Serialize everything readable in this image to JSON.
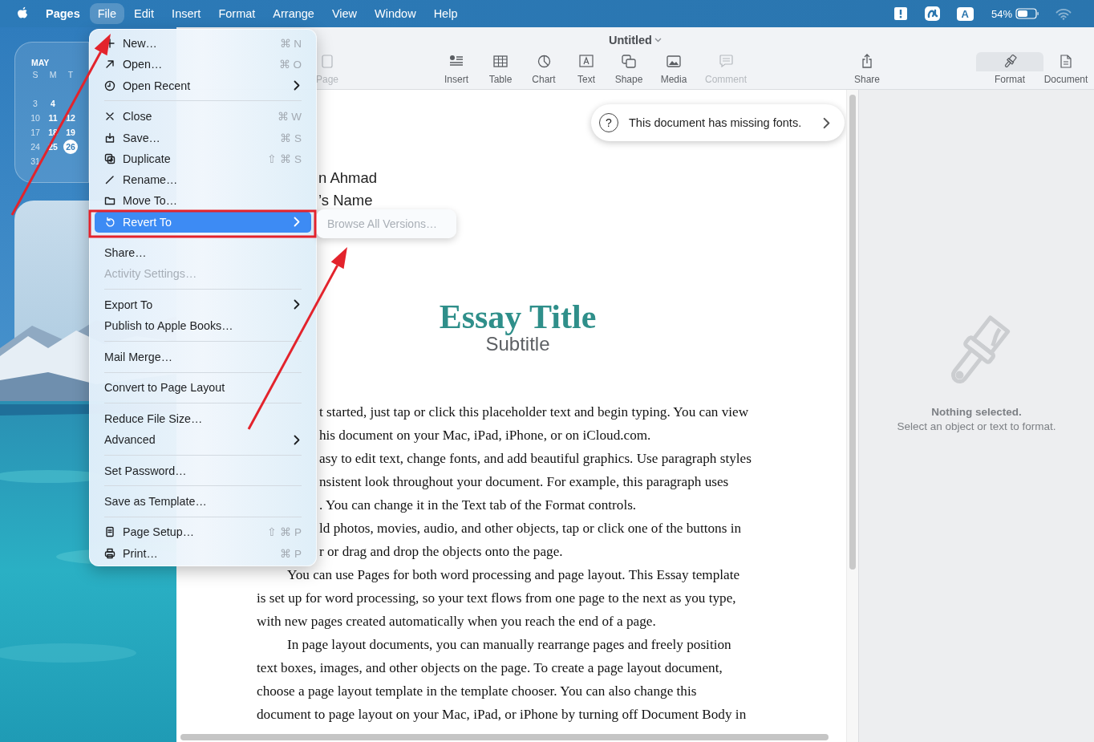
{
  "menu_bar": {
    "items": [
      {
        "label": "Pages",
        "kind": "app",
        "selected": false
      },
      {
        "label": "File",
        "kind": "menu",
        "selected": true
      },
      {
        "label": "Edit",
        "kind": "menu",
        "selected": false
      },
      {
        "label": "Insert",
        "kind": "menu",
        "selected": false
      },
      {
        "label": "Format",
        "kind": "menu",
        "selected": false
      },
      {
        "label": "Arrange",
        "kind": "menu",
        "selected": false
      },
      {
        "label": "View",
        "kind": "menu",
        "selected": false
      },
      {
        "label": "Window",
        "kind": "menu",
        "selected": false
      },
      {
        "label": "Help",
        "kind": "menu",
        "selected": false
      }
    ],
    "status": {
      "input_source": "A",
      "battery_percent": "54%"
    }
  },
  "desktop": {
    "calendar": {
      "month": "MAY",
      "weekdays": [
        "S",
        "M",
        "T"
      ],
      "weeks": [
        [
          {
            "day": "3",
            "selected": false
          },
          {
            "day": "4",
            "selected": false
          }
        ],
        [
          {
            "day": "10",
            "selected": false
          },
          {
            "day": "11",
            "selected": false
          },
          {
            "day": "12",
            "selected": false
          }
        ],
        [
          {
            "day": "17",
            "selected": false
          },
          {
            "day": "18",
            "selected": false
          },
          {
            "day": "19",
            "selected": false
          }
        ],
        [
          {
            "day": "24",
            "selected": false
          },
          {
            "day": "25",
            "selected": false
          },
          {
            "day": "26",
            "selected": true
          }
        ],
        [
          {
            "day": "31",
            "selected": false
          }
        ]
      ]
    }
  },
  "window": {
    "title": "Untitled",
    "toolbar": [
      {
        "label": "Page",
        "disabled": true,
        "selected": false
      },
      {
        "label": "Insert",
        "disabled": false,
        "selected": false
      },
      {
        "label": "Table",
        "disabled": false,
        "selected": false
      },
      {
        "label": "Chart",
        "disabled": false,
        "selected": false
      },
      {
        "label": "Text",
        "disabled": false,
        "selected": false
      },
      {
        "label": "Shape",
        "disabled": false,
        "selected": false
      },
      {
        "label": "Media",
        "disabled": false,
        "selected": false
      },
      {
        "label": "Comment",
        "disabled": true,
        "selected": false
      },
      {
        "label": "Share",
        "disabled": false,
        "selected": false
      },
      {
        "label": "Format",
        "disabled": false,
        "selected": true
      },
      {
        "label": "Document",
        "disabled": false,
        "selected": false
      }
    ]
  },
  "notice": {
    "help_glyph": "?",
    "text": "This document has missing fonts."
  },
  "document": {
    "author_lines": [
      "n Ahmad",
      "’s Name"
    ],
    "title": "Essay Title",
    "subtitle": "Subtitle",
    "lines": [
      {
        "kind": "cut",
        "text": "t started, just tap or click this placeholder text and begin typing. You can view"
      },
      {
        "kind": "cut",
        "text": "his document on your Mac, iPad, iPhone, or on iCloud.com."
      },
      {
        "kind": "cut",
        "text": "asy to edit text, change fonts, and add beautiful graphics. Use paragraph styles"
      },
      {
        "kind": "cut",
        "text": "nsistent look throughout your document. For example, this paragraph uses"
      },
      {
        "kind": "cut",
        "text": ". You can change it in the Text tab of the Format controls."
      },
      {
        "kind": "cut",
        "text": "ld photos, movies, audio, and other objects, tap or click one of the buttons in"
      },
      {
        "kind": "cut",
        "text": "r or drag and drop the objects onto the page."
      },
      {
        "kind": "indent",
        "text": "You can use Pages for both word processing and page layout. This Essay template"
      },
      {
        "kind": "plain",
        "text": "is set up for word processing, so your text flows from one page to the next as you type,"
      },
      {
        "kind": "plain",
        "text": "with new pages created automatically when you reach the end of a page."
      },
      {
        "kind": "indent",
        "text": "In page layout documents, you can manually rearrange pages and freely position"
      },
      {
        "kind": "plain",
        "text": "text boxes, images, and other objects on the page. To create a page layout document,"
      },
      {
        "kind": "plain",
        "text": "choose a page layout template in the template chooser. You can also change this"
      },
      {
        "kind": "plain",
        "text": "document to page layout on your Mac, iPad, or iPhone by turning off Document Body in"
      }
    ]
  },
  "inspector": {
    "heading": "Nothing selected.",
    "hint": "Select an object or text to format."
  },
  "file_menu": [
    {
      "kind": "item",
      "label": "New…",
      "shortcut": "⌘ N",
      "submenu": false,
      "disabled": false,
      "selected": false
    },
    {
      "kind": "item",
      "label": "Open…",
      "shortcut": "⌘ O",
      "submenu": false,
      "disabled": false,
      "selected": false
    },
    {
      "kind": "item",
      "label": "Open Recent",
      "submenu": true,
      "disabled": false,
      "selected": false
    },
    {
      "kind": "separator"
    },
    {
      "kind": "item",
      "label": "Close",
      "shortcut": "⌘ W",
      "submenu": false,
      "disabled": false,
      "selected": false
    },
    {
      "kind": "item",
      "label": "Save…",
      "shortcut": "⌘ S",
      "submenu": false,
      "disabled": false,
      "selected": false
    },
    {
      "kind": "item",
      "label": "Duplicate",
      "shortcut": "⇧ ⌘ S",
      "submenu": false,
      "disabled": false,
      "selected": false
    },
    {
      "kind": "item",
      "label": "Rename…",
      "submenu": false,
      "disabled": false,
      "selected": false
    },
    {
      "kind": "item",
      "label": "Move To…",
      "submenu": false,
      "disabled": false,
      "selected": false
    },
    {
      "kind": "item",
      "label": "Revert To",
      "submenu": true,
      "disabled": false,
      "selected": true
    },
    {
      "kind": "separator"
    },
    {
      "kind": "item",
      "label": "Share…",
      "submenu": false,
      "disabled": false,
      "selected": false
    },
    {
      "kind": "item",
      "label": "Activity Settings…",
      "submenu": false,
      "disabled": true,
      "selected": false
    },
    {
      "kind": "separator"
    },
    {
      "kind": "item",
      "label": "Export To",
      "submenu": true,
      "disabled": false,
      "selected": false
    },
    {
      "kind": "item",
      "label": "Publish to Apple Books…",
      "submenu": false,
      "disabled": false,
      "selected": false
    },
    {
      "kind": "separator"
    },
    {
      "kind": "item",
      "label": "Mail Merge…",
      "submenu": false,
      "disabled": false,
      "selected": false
    },
    {
      "kind": "separator"
    },
    {
      "kind": "item",
      "label": "Convert to Page Layout",
      "submenu": false,
      "disabled": false,
      "selected": false
    },
    {
      "kind": "separator"
    },
    {
      "kind": "item",
      "label": "Reduce File Size…",
      "submenu": false,
      "disabled": false,
      "selected": false
    },
    {
      "kind": "item",
      "label": "Advanced",
      "submenu": true,
      "disabled": false,
      "selected": false
    },
    {
      "kind": "separator"
    },
    {
      "kind": "item",
      "label": "Set Password…",
      "submenu": false,
      "disabled": false,
      "selected": false
    },
    {
      "kind": "separator"
    },
    {
      "kind": "item",
      "label": "Save as Template…",
      "submenu": false,
      "disabled": false,
      "selected": false
    },
    {
      "kind": "separator"
    },
    {
      "kind": "item",
      "label": "Page Setup…",
      "shortcut": "⇧ ⌘ P",
      "submenu": false,
      "disabled": false,
      "selected": false
    },
    {
      "kind": "item",
      "label": "Print…",
      "shortcut": "⌘ P",
      "submenu": false,
      "disabled": false,
      "selected": false
    }
  ],
  "submenu": [
    {
      "label": "Browse All Versions…",
      "disabled": true
    }
  ],
  "annotations": [
    {
      "kind": "arrow"
    },
    {
      "kind": "arrow"
    },
    {
      "kind": "frame"
    }
  ]
}
